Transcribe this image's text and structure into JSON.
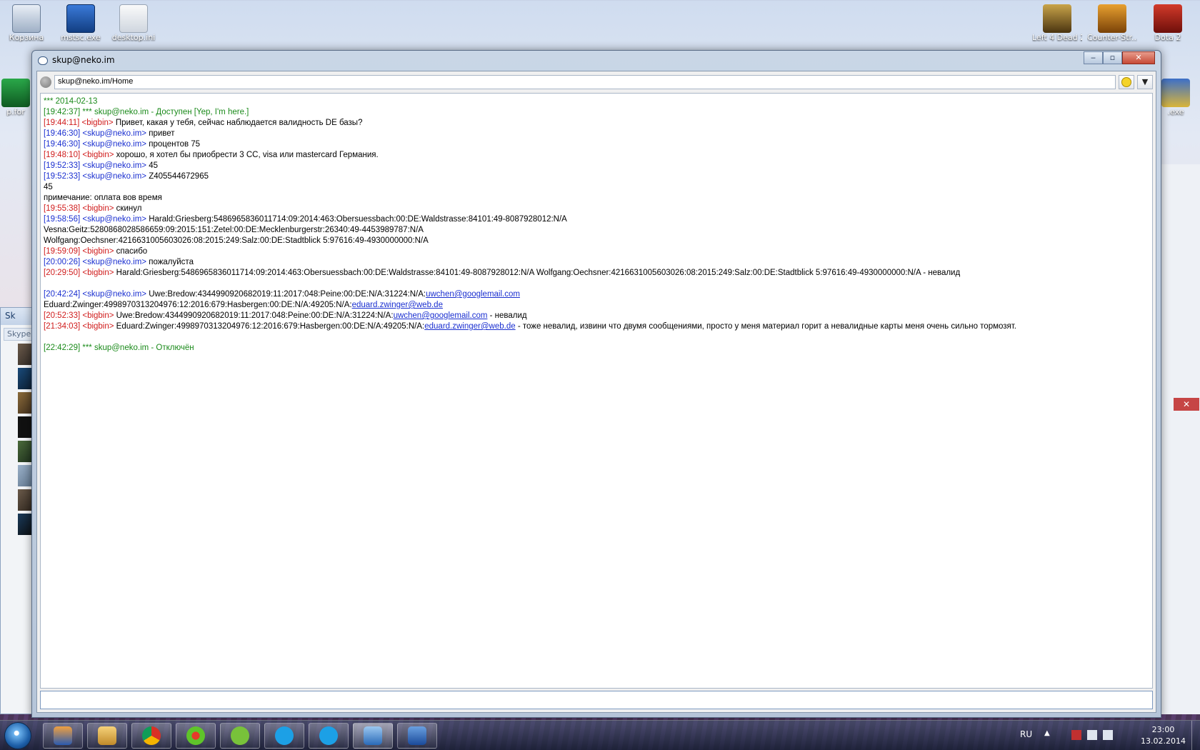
{
  "desktop": {
    "icons": [
      {
        "label": "Корзина"
      },
      {
        "label": "mstsc.exe"
      },
      {
        "label": "desktop.ini"
      },
      {
        "label": "Left 4 Dead 2"
      },
      {
        "label": "Counter-Str..."
      },
      {
        "label": "Dota 2"
      },
      {
        "label": "p.for"
      },
      {
        "label": ".exe"
      }
    ]
  },
  "bg_skype": {
    "title": "Sk",
    "search_placeholder": "Skype"
  },
  "chat_window": {
    "title": "skup@neko.im",
    "address": "skup@neko.im/Home",
    "buttons": {
      "minimize": "‒",
      "maximize": "▫",
      "close": "✕",
      "menu": "▼"
    }
  },
  "log": [
    {
      "type": "status",
      "text": "*** 2014-02-13"
    },
    {
      "type": "status",
      "text": "[19:42:37] *** skup@neko.im - Доступен [Yep, I'm here.]"
    },
    {
      "type": "msg",
      "who": "them",
      "ts": "[19:44:11]",
      "nick": "<bigbin>",
      "text": "Привет, какая у тебя, сейчас наблюдается валидность DE базы?"
    },
    {
      "type": "msg",
      "who": "me",
      "ts": "[19:46:30]",
      "nick": "<skup@neko.im>",
      "text": "привет"
    },
    {
      "type": "msg",
      "who": "me",
      "ts": "[19:46:30]",
      "nick": "<skup@neko.im>",
      "text": "процентов 75"
    },
    {
      "type": "msg",
      "who": "them",
      "ts": "[19:48:10]",
      "nick": "<bigbin>",
      "text": "хорошо, я хотел бы приобрести 3 CC, visa или mastercard Германия."
    },
    {
      "type": "msg",
      "who": "me",
      "ts": "[19:52:33]",
      "nick": "<skup@neko.im>",
      "text": "45"
    },
    {
      "type": "msg",
      "who": "me",
      "ts": "[19:52:33]",
      "nick": "<skup@neko.im>",
      "text": "Z405544672965"
    },
    {
      "type": "plain",
      "text": "45"
    },
    {
      "type": "plain",
      "text": "примечание: оплата вов время"
    },
    {
      "type": "msg",
      "who": "them",
      "ts": "[19:55:38]",
      "nick": "<bigbin>",
      "text": "скинул"
    },
    {
      "type": "msg",
      "who": "me",
      "ts": "[19:58:56]",
      "nick": "<skup@neko.im>",
      "text": "Harald:Griesberg:5486965836011714:09:2014:463:Obersuessbach:00:DE:Waldstrasse:84101:49-8087928012:N/A"
    },
    {
      "type": "plain",
      "text": "Vesna:Geitz:5280868028586659:09:2015:151:Zetel:00:DE:Mecklenburgerstr:26340:49-4453989787:N/A"
    },
    {
      "type": "plain",
      "text": "Wolfgang:Oechsner:4216631005603026:08:2015:249:Salz:00:DE:Stadtblick 5:97616:49-4930000000:N/A"
    },
    {
      "type": "msg",
      "who": "them",
      "ts": "[19:59:09]",
      "nick": "<bigbin>",
      "text": "спасибо"
    },
    {
      "type": "msg",
      "who": "me",
      "ts": "[20:00:26]",
      "nick": "<skup@neko.im>",
      "text": "пожалуйста"
    },
    {
      "type": "msg",
      "who": "them",
      "ts": "[20:29:50]",
      "nick": "<bigbin>",
      "text": "Harald:Griesberg:5486965836011714:09:2014:463:Obersuessbach:00:DE:Waldstrasse:84101:49-8087928012:N/A Wolfgang:Oechsner:4216631005603026:08:2015:249:Salz:00:DE:Stadtblick 5:97616:49-4930000000:N/A  -  невалид"
    },
    {
      "type": "blank"
    },
    {
      "type": "msg",
      "who": "me",
      "ts": "[20:42:24]",
      "nick": "<skup@neko.im>",
      "text": "Uwe:Bredow:4344990920682019:11:2017:048:Peine:00:DE:N/A:31224:N/A:",
      "link": "uwchen@googlemail.com"
    },
    {
      "type": "plain",
      "text": "Eduard:Zwinger:4998970313204976:12:2016:679:Hasbergen:00:DE:N/A:49205:N/A:",
      "link": "eduard.zwinger@web.de"
    },
    {
      "type": "msg",
      "who": "them",
      "ts": "[20:52:33]",
      "nick": "<bigbin>",
      "text": "Uwe:Bredow:4344990920682019:11:2017:048:Peine:00:DE:N/A:31224:N/A:",
      "link": "uwchen@googlemail.com",
      "after": " - невалид"
    },
    {
      "type": "msg",
      "who": "them",
      "ts": "[21:34:03]",
      "nick": "<bigbin>",
      "text": "Eduard:Zwinger:4998970313204976:12:2016:679:Hasbergen:00:DE:N/A:49205:N/A:",
      "link": "eduard.zwinger@web.de",
      "after": " - тоже невалид, извини что  двумя сообщениями, просто у меня материал горит а невалидные карты меня очень сильно тормозят."
    },
    {
      "type": "blank"
    },
    {
      "type": "status",
      "text": "[22:42:29] *** skup@neko.im - Отключён"
    }
  ],
  "input": {
    "value": ""
  },
  "taskbar": {
    "apps": [
      "media-player-icon",
      "explorer-icon",
      "chrome-icon",
      "icq-icon",
      "utorrent-icon",
      "skype-icon",
      "skype-icon",
      "psi-icon",
      "remote-desktop-icon"
    ],
    "lang": "RU",
    "time": "23:00",
    "date": "13.02.2014"
  },
  "colors": {
    "status": "#1a8a1a",
    "them": "#d01c1c",
    "me": "#1a2fd0"
  }
}
